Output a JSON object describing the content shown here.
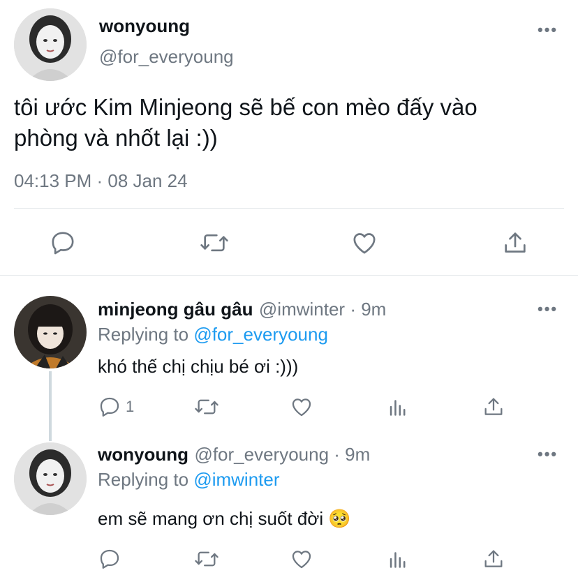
{
  "main_tweet": {
    "display_name": "wonyoung",
    "handle": "@for_everyoung",
    "text_line1": "tôi ước Kim Minjeong sẽ bế con mèo đấy vào",
    "text_line2": "phòng và nhốt lại :))",
    "timestamp": "04:13 PM · 08 Jan 24",
    "more": "•••"
  },
  "replies": [
    {
      "display_name": "minjeong gâu gâu",
      "meta": "@imwinter · 9m",
      "replying_prefix": "Replying to ",
      "replying_handle": "@for_everyoung",
      "text": "khó thế chị chịu bé ơi :)))",
      "reply_count": "1",
      "more": "•••"
    },
    {
      "display_name": "wonyoung",
      "meta": "@for_everyoung · 9m",
      "replying_prefix": "Replying to ",
      "replying_handle": "@imwinter",
      "text": "em sẽ mang ơn chị suốt đời",
      "emoji": "🥺",
      "reply_count": "",
      "more": "•••"
    }
  ],
  "colors": {
    "accent": "#1d9bf0",
    "muted": "#6e7781",
    "divider": "#e6e9ec"
  },
  "icons": [
    "reply-icon",
    "retweet-icon",
    "like-icon",
    "share-icon",
    "analytics-icon",
    "more-icon"
  ]
}
